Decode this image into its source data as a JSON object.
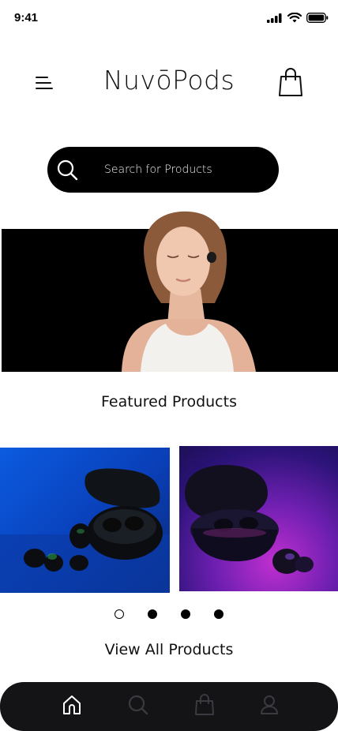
{
  "status_bar": {
    "time": "9:41"
  },
  "header": {
    "brand": "NuvōPods"
  },
  "search": {
    "placeholder": "Search for Products"
  },
  "featured": {
    "title": "Featured Products"
  },
  "carousel": {
    "slide_count": 4,
    "active_index": 0
  },
  "links": {
    "view_all": "View All Products"
  },
  "tab_bar": {
    "items": [
      "home-icon",
      "search-icon",
      "bag-icon",
      "profile-icon"
    ],
    "active": "home-icon"
  },
  "colors": {
    "dark": "#141417",
    "accent_blue": "#0b5be0",
    "accent_purple": "#7a22c0",
    "inactive_icon": "#3a3a40"
  }
}
